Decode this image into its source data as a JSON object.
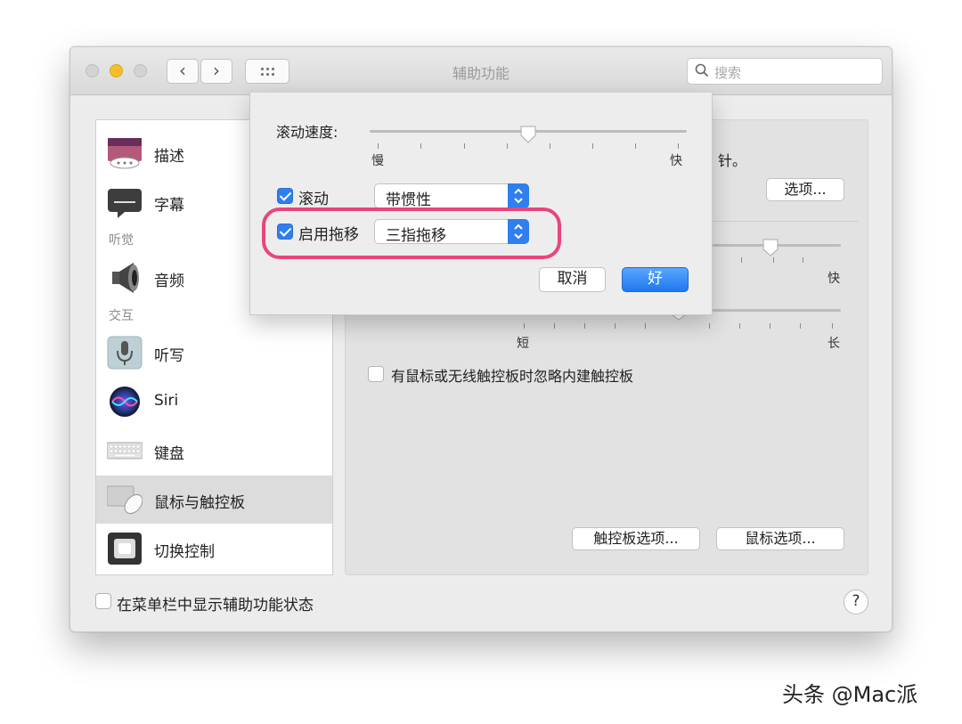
{
  "window": {
    "title": "辅助功能"
  },
  "search": {
    "placeholder": "搜索"
  },
  "sidebar": {
    "items": [
      {
        "label": "描述",
        "icon": "description-icon"
      },
      {
        "label": "字幕",
        "icon": "captions-icon"
      },
      {
        "label": "音频",
        "icon": "audio-icon"
      },
      {
        "label": "听写",
        "icon": "microphone-icon"
      },
      {
        "label": "Siri",
        "icon": "siri-icon"
      },
      {
        "label": "键盘",
        "icon": "keyboard-icon"
      },
      {
        "label": "鼠标与触控板",
        "icon": "mouse-trackpad-icon",
        "selected": true
      },
      {
        "label": "切换控制",
        "icon": "switch-control-icon"
      }
    ],
    "sections": [
      "听觉",
      "交互"
    ]
  },
  "panel": {
    "partial_text": "针。",
    "options_button": "选项...",
    "speed_fast_label": "快",
    "delay_short_label": "短",
    "delay_long_label": "长",
    "ignore_trackpad_label": "有鼠标或无线触控板时忽略内建触控板",
    "ignore_trackpad_checked": false,
    "trackpad_options_button": "触控板选项...",
    "mouse_options_button": "鼠标选项..."
  },
  "footer": {
    "show_status_label": "在菜单栏中显示辅助功能状态",
    "show_status_checked": false,
    "help": "?"
  },
  "sheet": {
    "scroll_speed_label": "滚动速度:",
    "scroll_speed_value": 0.5,
    "slow_label": "慢",
    "fast_label": "快",
    "scroll_label": "滚动",
    "scroll_checked": true,
    "scroll_mode": "带惯性",
    "drag_label": "启用拖移",
    "drag_checked": true,
    "drag_mode": "三指拖移",
    "cancel_button": "取消",
    "ok_button": "好"
  },
  "colors": {
    "accent": "#2f7fef",
    "highlight": "#e7457f"
  },
  "watermark": "头条 @Mac派"
}
